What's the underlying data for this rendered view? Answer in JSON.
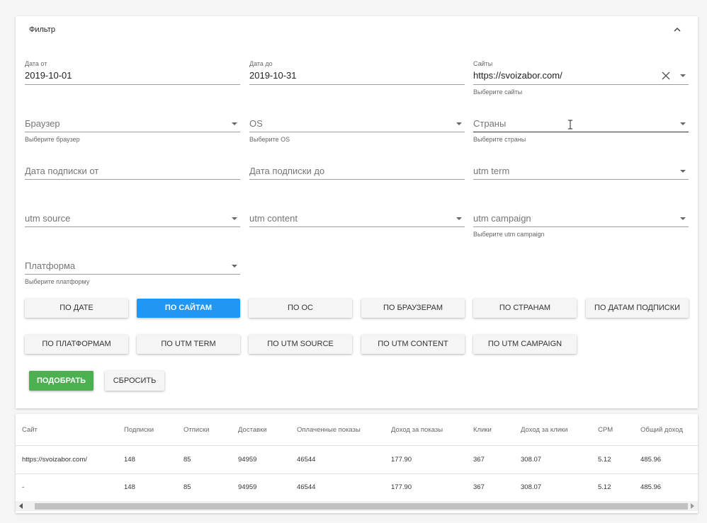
{
  "filter": {
    "title": "Фильтр",
    "fields": {
      "date_from": {
        "label": "Дата от",
        "value": "2019-10-01"
      },
      "date_to": {
        "label": "Дата до",
        "value": "2019-10-31"
      },
      "sites": {
        "label": "Сайты",
        "value": "https://svoizabor.com/",
        "hint": "Выберите сайты"
      },
      "browser": {
        "placeholder": "Браузер",
        "hint": "Выберите браузер"
      },
      "os": {
        "placeholder": "OS",
        "hint": "Выберите OS"
      },
      "countries": {
        "placeholder": "Страны",
        "hint": "Выберите страны"
      },
      "sub_date_from": {
        "placeholder": "Дата подписки от"
      },
      "sub_date_to": {
        "placeholder": "Дата подписки до"
      },
      "utm_term": {
        "placeholder": "utm term"
      },
      "utm_source": {
        "placeholder": "utm source"
      },
      "utm_content": {
        "placeholder": "utm content"
      },
      "utm_campaign": {
        "placeholder": "utm campaign",
        "hint": "Выберите utm campaign"
      },
      "platform": {
        "placeholder": "Платформа",
        "hint": "Выберите платформу"
      }
    },
    "group_buttons": [
      "ПО ДАТЕ",
      "ПО САЙТАМ",
      "ПО ОС",
      "ПО БРАУЗЕРАМ",
      "ПО СТРАНАМ",
      "ПО ДАТАМ ПОДПИСКИ",
      "ПО ПЛАТФОРМАМ",
      "ПО UTM TERM",
      "ПО UTM SOURCE",
      "ПО UTM CONTENT",
      "ПО UTM CAMPAIGN"
    ],
    "active_group": "ПО САЙТАМ",
    "apply_label": "ПОДОБРАТЬ",
    "reset_label": "СБРОСИТЬ"
  },
  "table": {
    "columns": [
      "Сайт",
      "Подписки",
      "Отписки",
      "Доставки",
      "Оплаченные показы",
      "Доход за показы",
      "Клики",
      "Доход за клики",
      "CPM",
      "Общий доход"
    ],
    "rows": [
      [
        "https://svoizabor.com/",
        "148",
        "85",
        "94959",
        "46544",
        "177.90",
        "367",
        "308.07",
        "5.12",
        "485.96"
      ],
      [
        "-",
        "148",
        "85",
        "94959",
        "46544",
        "177.90",
        "367",
        "308.07",
        "5.12",
        "485.96"
      ]
    ]
  },
  "colors": {
    "accent": "#2196f3",
    "success": "#4caf50"
  }
}
